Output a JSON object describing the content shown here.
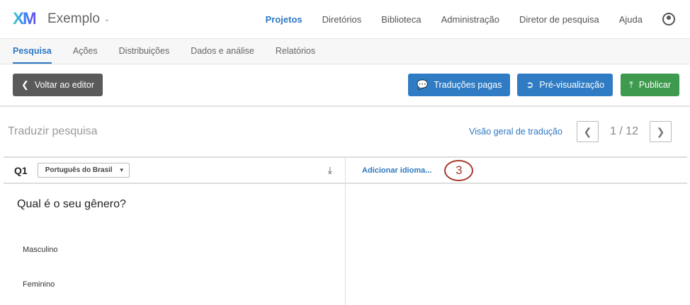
{
  "header": {
    "logo": "XM",
    "project": "Exemplo",
    "nav": [
      "Projetos",
      "Diretórios",
      "Biblioteca",
      "Administração",
      "Diretor de pesquisa",
      "Ajuda"
    ],
    "active_nav": "Projetos"
  },
  "tabs": [
    "Pesquisa",
    "Ações",
    "Distribuições",
    "Dados e análise",
    "Relatórios"
  ],
  "toolbar": {
    "back": "Voltar ao editor",
    "paid": "Traduções pagas",
    "preview": "Pré-visualização",
    "publish": "Publicar"
  },
  "translate": {
    "title": "Traduzir pesquisa",
    "overview": "Visão geral de tradução",
    "page": "1 / 12"
  },
  "question": {
    "id": "Q1",
    "language": "Português do Brasil",
    "text": "Qual é o seu gênero?",
    "choices": [
      "Masculino",
      "Feminino"
    ]
  },
  "add_language": "Adicionar idioma...",
  "annotation": "3"
}
